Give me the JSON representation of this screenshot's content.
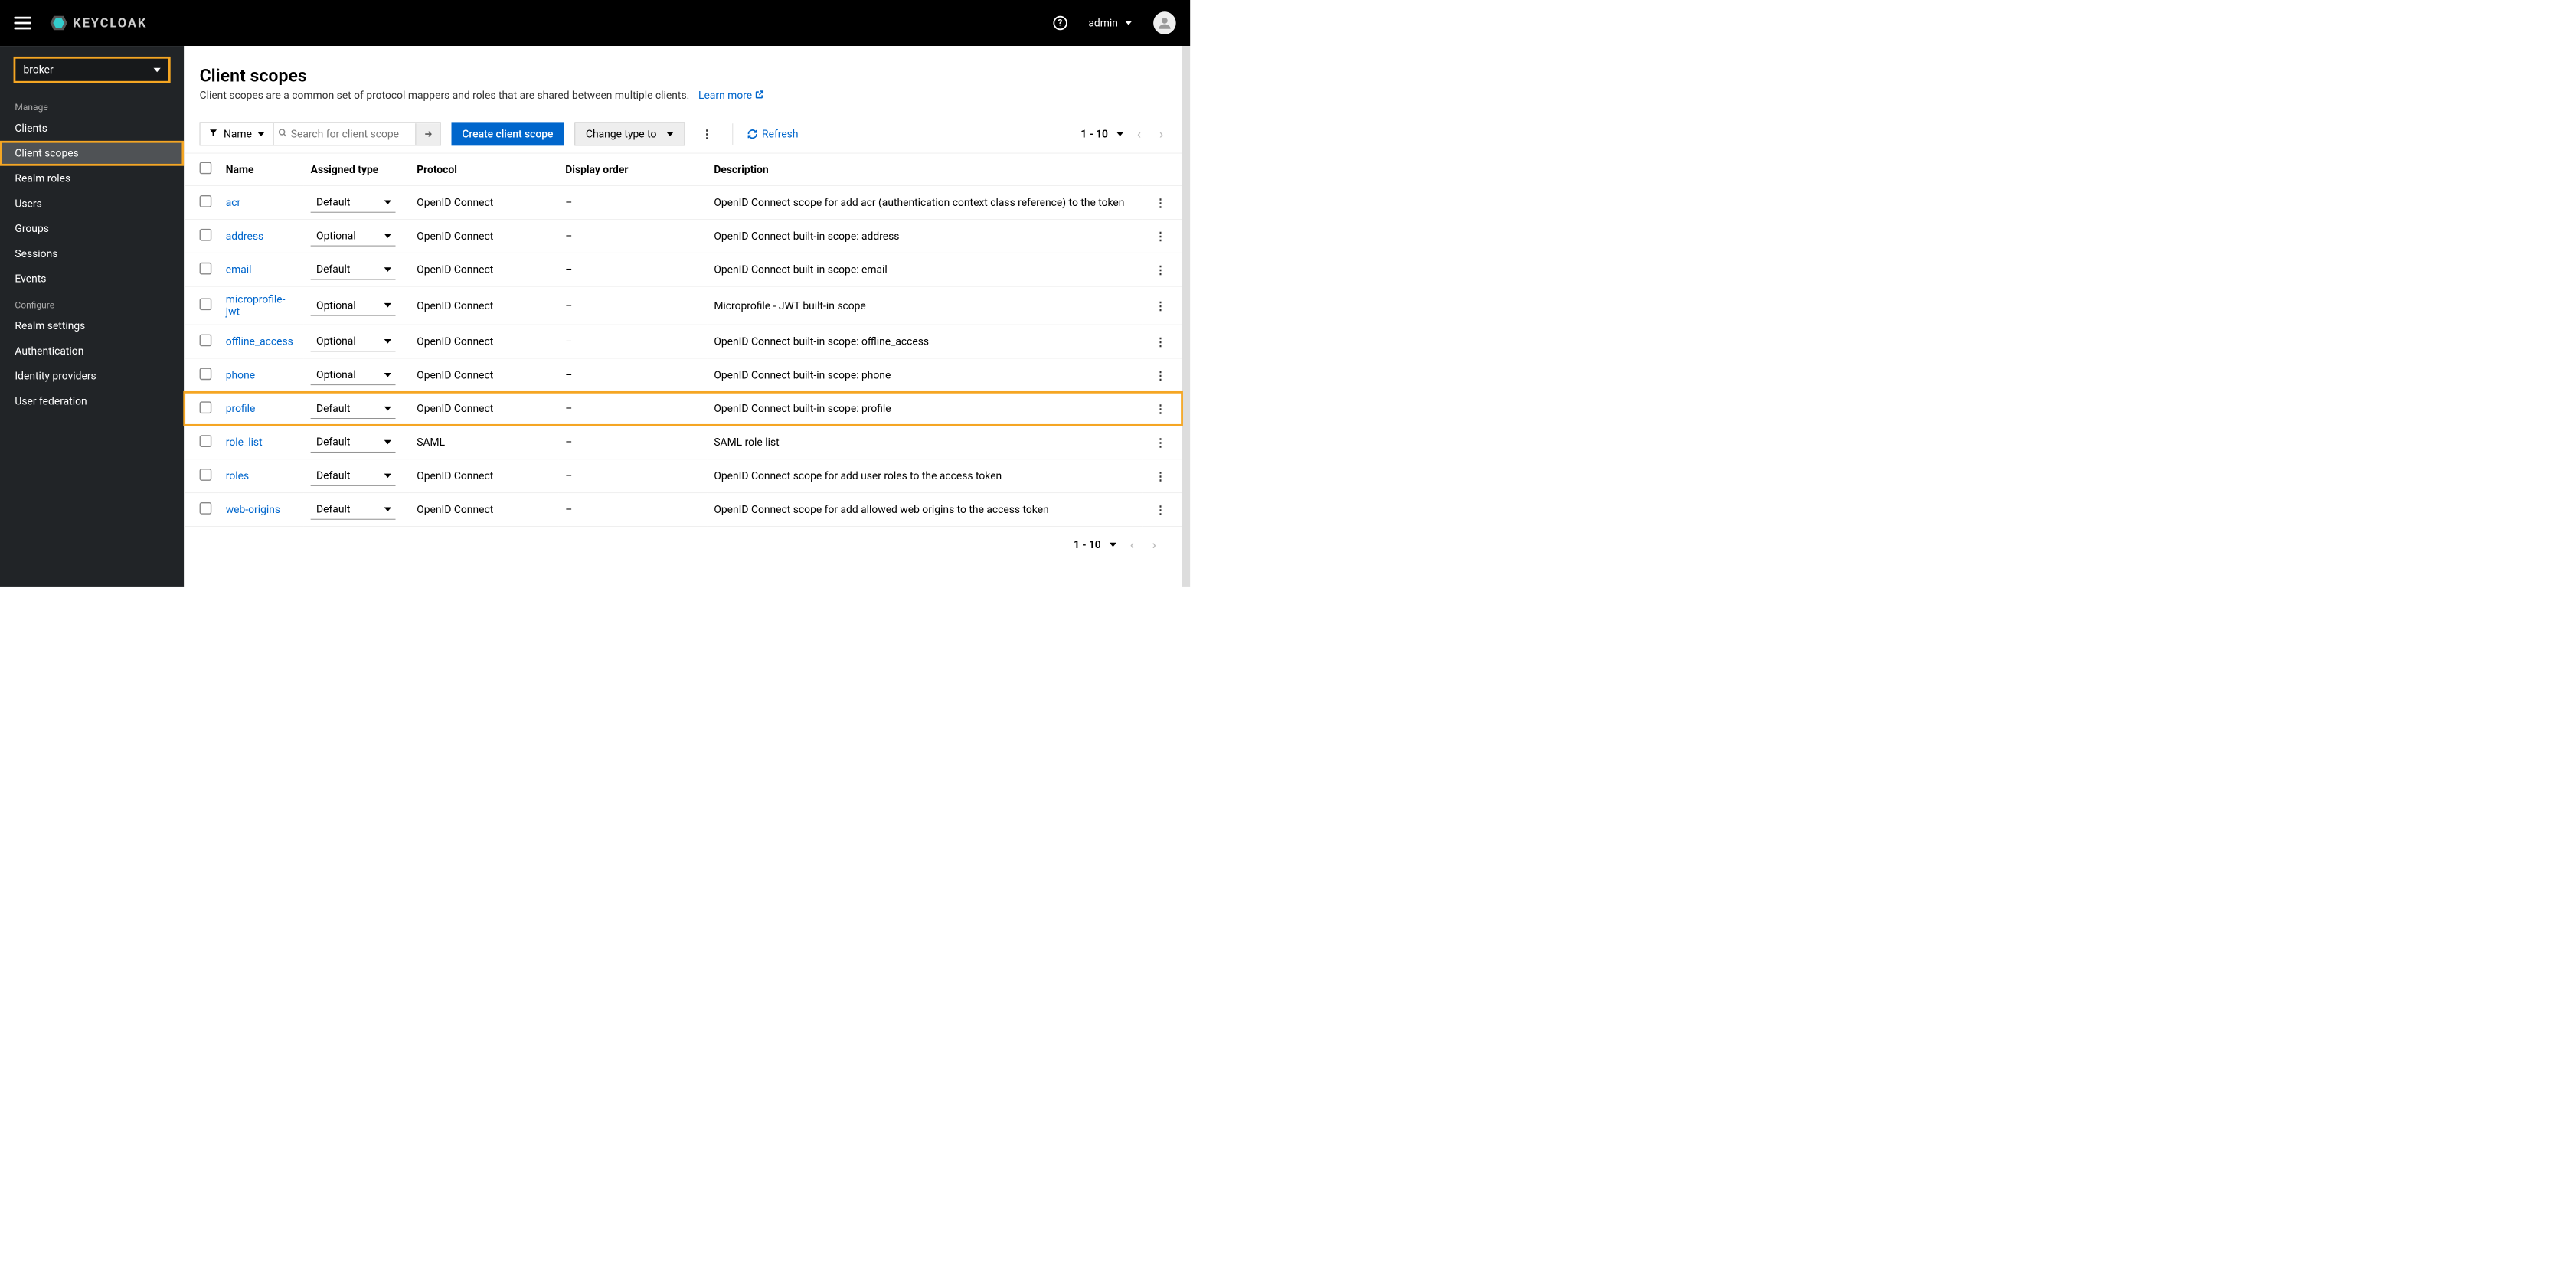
{
  "header": {
    "brand": "KEYCLOAK",
    "user_label": "admin"
  },
  "sidebar": {
    "realm_selected": "broker",
    "sections": [
      {
        "label": "Manage",
        "items": [
          {
            "label": "Clients",
            "name": "sidebar-item-clients"
          },
          {
            "label": "Client scopes",
            "name": "sidebar-item-client-scopes",
            "active": true
          },
          {
            "label": "Realm roles",
            "name": "sidebar-item-realm-roles"
          },
          {
            "label": "Users",
            "name": "sidebar-item-users"
          },
          {
            "label": "Groups",
            "name": "sidebar-item-groups"
          },
          {
            "label": "Sessions",
            "name": "sidebar-item-sessions"
          },
          {
            "label": "Events",
            "name": "sidebar-item-events"
          }
        ]
      },
      {
        "label": "Configure",
        "items": [
          {
            "label": "Realm settings",
            "name": "sidebar-item-realm-settings"
          },
          {
            "label": "Authentication",
            "name": "sidebar-item-authentication"
          },
          {
            "label": "Identity providers",
            "name": "sidebar-item-identity-providers"
          },
          {
            "label": "User federation",
            "name": "sidebar-item-user-federation"
          }
        ]
      }
    ]
  },
  "page": {
    "title": "Client scopes",
    "description": "Client scopes are a common set of protocol mappers and roles that are shared between multiple clients.",
    "learn_more": "Learn more"
  },
  "toolbar": {
    "filter_label": "Name",
    "search_placeholder": "Search for client scope",
    "create_label": "Create client scope",
    "change_type_label": "Change type to",
    "refresh_label": "Refresh",
    "page_range": "1 - 10"
  },
  "table": {
    "columns": {
      "name": "Name",
      "assigned_type": "Assigned type",
      "protocol": "Protocol",
      "display_order": "Display order",
      "description": "Description"
    },
    "rows": [
      {
        "name": "acr",
        "type": "Default",
        "protocol": "OpenID Connect",
        "order": "–",
        "desc": "OpenID Connect scope for add acr (authentication context class reference) to the token"
      },
      {
        "name": "address",
        "type": "Optional",
        "protocol": "OpenID Connect",
        "order": "–",
        "desc": "OpenID Connect built-in scope: address"
      },
      {
        "name": "email",
        "type": "Default",
        "protocol": "OpenID Connect",
        "order": "–",
        "desc": "OpenID Connect built-in scope: email"
      },
      {
        "name": "microprofile-jwt",
        "type": "Optional",
        "protocol": "OpenID Connect",
        "order": "–",
        "desc": "Microprofile - JWT built-in scope"
      },
      {
        "name": "offline_access",
        "type": "Optional",
        "protocol": "OpenID Connect",
        "order": "–",
        "desc": "OpenID Connect built-in scope: offline_access"
      },
      {
        "name": "phone",
        "type": "Optional",
        "protocol": "OpenID Connect",
        "order": "–",
        "desc": "OpenID Connect built-in scope: phone"
      },
      {
        "name": "profile",
        "type": "Default",
        "protocol": "OpenID Connect",
        "order": "–",
        "desc": "OpenID Connect built-in scope: profile",
        "highlighted": true
      },
      {
        "name": "role_list",
        "type": "Default",
        "protocol": "SAML",
        "order": "–",
        "desc": "SAML role list"
      },
      {
        "name": "roles",
        "type": "Default",
        "protocol": "OpenID Connect",
        "order": "–",
        "desc": "OpenID Connect scope for add user roles to the access token"
      },
      {
        "name": "web-origins",
        "type": "Default",
        "protocol": "OpenID Connect",
        "order": "–",
        "desc": "OpenID Connect scope for add allowed web origins to the access token"
      }
    ]
  },
  "footer": {
    "page_range": "1 - 10"
  }
}
